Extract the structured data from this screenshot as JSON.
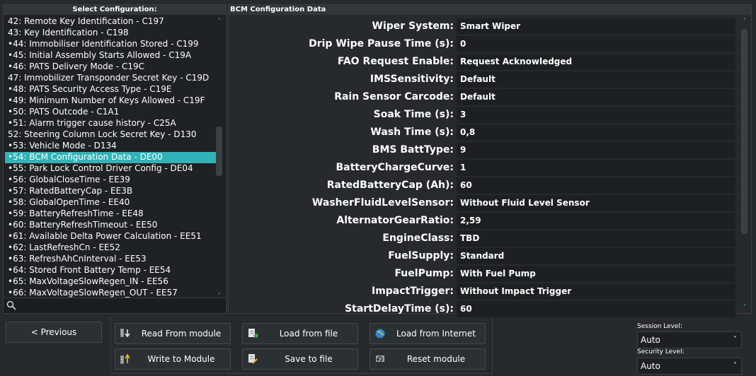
{
  "left": {
    "title": "Select Configuration:",
    "items": [
      "42: Remote Key Identification - C197",
      "43: Key Identification - C198",
      "•44: Immobiliser Identification Stored - C199",
      "•45: Initial Assembly Starts Allowed - C19A",
      "•46: PATS Delivery Mode - C19C",
      "47: Immobilizer Transponder Secret Key - C19D",
      "•48: PATS Security Access Type - C19E",
      "•49: Minimum Number of Keys Allowed - C19F",
      "•50: PATS Outcode - C1A1",
      "•51: Alarm trigger cause history - C25A",
      "52: Steering Column Lock Secret Key - D130",
      "•53: Vehicle Mode - D134",
      "•54: BCM Configuration Data - DE00",
      "•55: Park Lock Control Driver Config - DE04",
      "•56: GlobalCloseTime - EE39",
      "•57: RatedBatteryCap - EE3B",
      "•58: GlobalOpenTime - EE40",
      "•59: BatteryRefreshTime - EE48",
      "•60: BatteryRefreshTimeout - EE50",
      "•61: Available Delta Power Calculation - EE51",
      "•62: LastRefreshCn - EE52",
      "•63: RefreshAhCnInterval - EE53",
      "•64: Stored Front Battery Temp - EE54",
      "•65: MaxVoltageSlowRegen_IN - EE56",
      "•66: MaxVoltageSlowRegen_OUT - EE57"
    ],
    "selected_index": 12,
    "search_value": ""
  },
  "right": {
    "title": "BCM Configuration Data",
    "fields": [
      {
        "label": "Wiper System:",
        "value": "Smart Wiper"
      },
      {
        "label": "Drip Wipe Pause Time (s):",
        "value": "0"
      },
      {
        "label": "FAO Request Enable:",
        "value": "Request Acknowledged"
      },
      {
        "label": "IMSSensitivity:",
        "value": "Default"
      },
      {
        "label": "Rain Sensor Carcode:",
        "value": "Default"
      },
      {
        "label": "Soak Time (s):",
        "value": "3"
      },
      {
        "label": "Wash Time (s):",
        "value": "0,8"
      },
      {
        "label": "BMS BattType:",
        "value": "9"
      },
      {
        "label": "BatteryChargeCurve:",
        "value": "1"
      },
      {
        "label": "RatedBatteryCap (Ah):",
        "value": "60"
      },
      {
        "label": "WasherFluidLevelSensor:",
        "value": "Without Fluid Level Sensor"
      },
      {
        "label": "AlternatorGearRatio:",
        "value": "2,59"
      },
      {
        "label": "EngineClass:",
        "value": "TBD"
      },
      {
        "label": "FuelSupply:",
        "value": "Standard"
      },
      {
        "label": "FuelPump:",
        "value": "With Fuel Pump"
      },
      {
        "label": "ImpactTrigger:",
        "value": "Without Impact Trigger"
      },
      {
        "label": "StartDelayTime (s):",
        "value": "60"
      }
    ]
  },
  "buttons": {
    "previous": "< Previous",
    "read_from_module": "Read From module",
    "write_to_module": "Write to Module",
    "load_from_file": "Load from file",
    "save_to_file": "Save to file",
    "load_from_internet": "Load from Internet",
    "reset_module": "Reset module"
  },
  "session": {
    "label": "Session Level:",
    "value": "Auto"
  },
  "security": {
    "label": "Security Level:",
    "value": "Auto"
  },
  "colors": {
    "accent": "#2fb3b8",
    "background": "#262a2d",
    "field_bg": "#1d2022"
  }
}
